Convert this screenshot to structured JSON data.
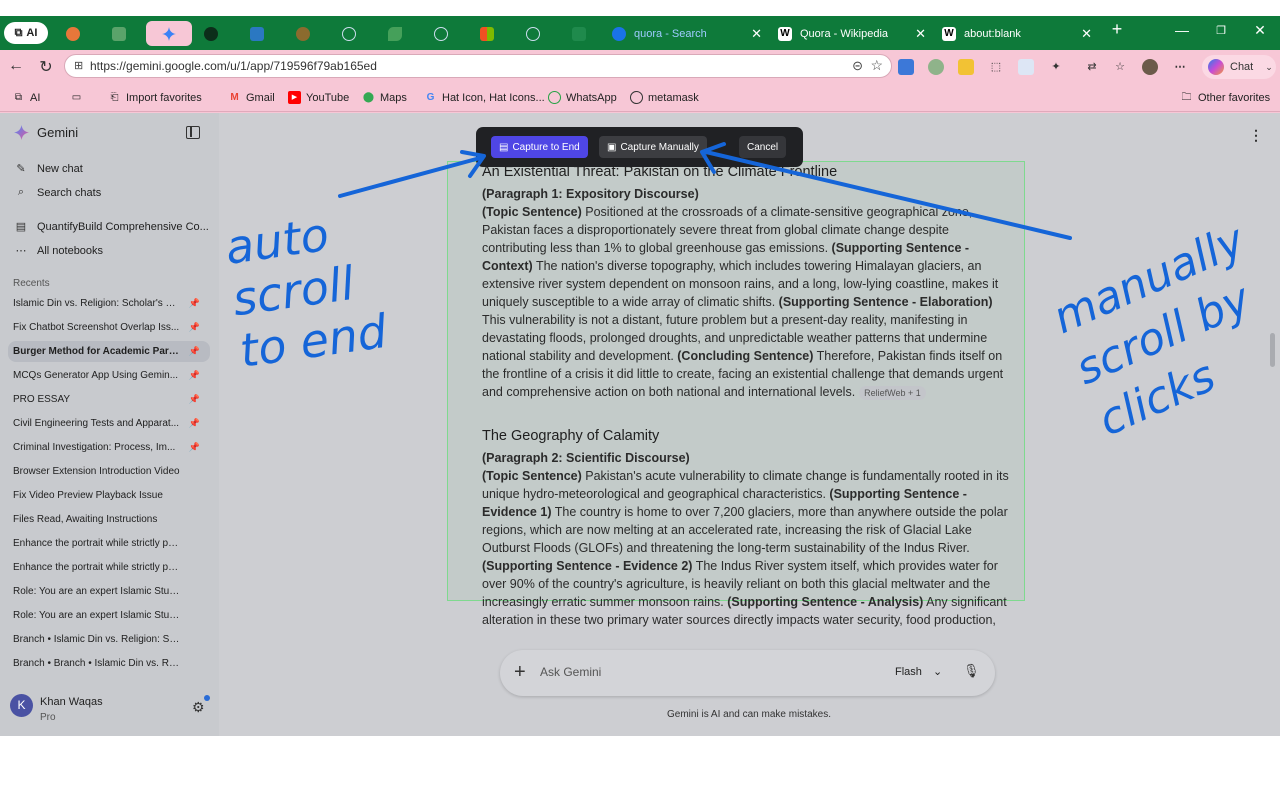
{
  "browser": {
    "ai_pill": "AI",
    "tabs": [
      {
        "title": "quora - Search",
        "color": "#1a73e8"
      },
      {
        "title": "Quora - Wikipedia",
        "color": "#ffffff"
      },
      {
        "title": "about:blank",
        "color": "#ffffff"
      }
    ],
    "new_tab": "+",
    "url": "https://gemini.google.com/u/1/app/719596f79ab165ed",
    "chat_label": "Chat",
    "bookmarks": [
      "AI",
      "Import favorites",
      "Gmail",
      "YouTube",
      "Maps",
      "Hat Icon, Hat Icons...",
      "WhatsApp",
      "metamask"
    ],
    "other_favorites": "Other favorites"
  },
  "sidebar": {
    "brand": "Gemini",
    "new_chat": "New chat",
    "search_chats": "Search chats",
    "notebook": "QuantifyBuild Comprehensive Co...",
    "all_notebooks": "All notebooks",
    "recents_label": "Recents",
    "recents": [
      {
        "title": "Islamic Din vs. Religion: Scholar's G...",
        "pinned": true
      },
      {
        "title": "Fix Chatbot Screenshot Overlap Iss...",
        "pinned": true
      },
      {
        "title": "Burger Method for Academic Para...",
        "pinned": true,
        "active": true
      },
      {
        "title": "MCQs Generator App Using Gemin...",
        "pinned": true
      },
      {
        "title": "PRO ESSAY",
        "pinned": true
      },
      {
        "title": "Civil Engineering Tests and Apparat...",
        "pinned": true
      },
      {
        "title": "Criminal Investigation: Process, Im...",
        "pinned": true
      },
      {
        "title": "Browser Extension Introduction Video",
        "pinned": false
      },
      {
        "title": "Fix Video Preview Playback Issue",
        "pinned": false
      },
      {
        "title": "Files Read, Awaiting Instructions",
        "pinned": false
      },
      {
        "title": "Enhance the portrait while strictly pres...",
        "pinned": false
      },
      {
        "title": "Enhance the portrait while strictly pres...",
        "pinned": false
      },
      {
        "title": "Role: You are an expert Islamic Studies ...",
        "pinned": false
      },
      {
        "title": "Role: You are an expert Islamic Studies ...",
        "pinned": false
      },
      {
        "title": "Branch • Islamic Din vs. Religion: Schola...",
        "pinned": false
      },
      {
        "title": "Branch • Branch • Islamic Din vs. Religio...",
        "pinned": false
      }
    ],
    "user_initial": "K",
    "user_name": "Khan Waqas",
    "user_plan": "Pro"
  },
  "capture_toolbar": {
    "capture_end": "Capture to End",
    "capture_manual": "Capture Manually",
    "cancel": "Cancel"
  },
  "article": {
    "heading1": "An Existential Threat: Pakistan on the Climate Frontline",
    "para1_label": "(Paragraph 1: Expository Discourse)",
    "p1_s1_tag": "(Topic Sentence)",
    "p1_s1": " Positioned at the crossroads of a climate-sensitive geographical zone, Pakistan faces a disproportionately severe threat from global climate change despite contributing less than 1% to global greenhouse gas emissions. ",
    "p1_s2_tag": "(Supporting Sentence - Context)",
    "p1_s2": " The nation's diverse topography, which includes towering Himalayan glaciers, an extensive river system dependent on monsoon rains, and a long, low-lying coastline, makes it uniquely susceptible to a wide array of climatic shifts. ",
    "p1_s3_tag": "(Supporting Sentence - Elaboration)",
    "p1_s3": " This vulnerability is not a distant, future problem but a present-day reality, manifesting in devastating floods, prolonged droughts, and unpredictable weather patterns that undermine national stability and development. ",
    "p1_s4_tag": "(Concluding Sentence)",
    "p1_s4": " Therefore, Pakistan finds itself on the frontline of a crisis it did little to create, facing an existential challenge that demands urgent and comprehensive action on both national and international levels.",
    "p1_source": "ReliefWeb + 1",
    "heading2": "The Geography of Calamity",
    "para2_label": "(Paragraph 2: Scientific Discourse)",
    "p2_s1_tag": "(Topic Sentence)",
    "p2_s1": " Pakistan's acute vulnerability to climate change is fundamentally rooted in its unique hydro-meteorological and geographical characteristics. ",
    "p2_s2_tag": "(Supporting Sentence - Evidence 1)",
    "p2_s2": " The country is home to over 7,200 glaciers, more than anywhere outside the polar regions, which are now melting at an accelerated rate, increasing the risk of Glacial Lake Outburst Floods (GLOFs) and threatening the long-term sustainability of the Indus River. ",
    "p2_s3_tag": "(Supporting Sentence - Evidence 2)",
    "p2_s3": " The Indus River system itself, which provides water for over 90% of the country's agriculture, is heavily reliant on both this glacial meltwater and the increasingly erratic summer monsoon rains. ",
    "p2_s4_tag": "(Supporting Sentence - Analysis)",
    "p2_s4": " Any significant alteration in these two primary water sources directly impacts water security, food production,"
  },
  "input": {
    "placeholder": "Ask Gemini",
    "mode": "Flash",
    "disclaimer": "Gemini is AI and can make mistakes."
  },
  "annotations": {
    "left_note": "auto scroll to end",
    "right_note": "manually scroll by clicks",
    "ink_color": "#1565d8"
  }
}
